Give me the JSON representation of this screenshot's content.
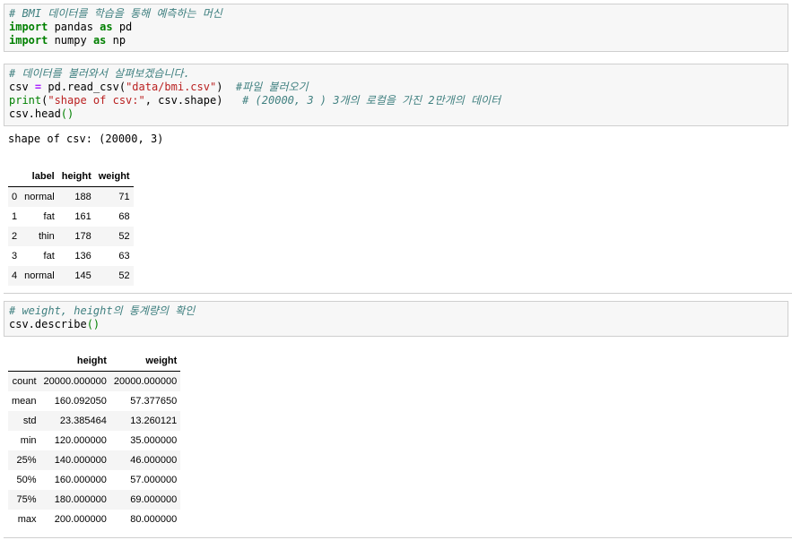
{
  "cell1": {
    "lines": [
      [
        {
          "t": "# BMI 데이터를 학습을 통해 예측하는 머신",
          "c": "cm"
        }
      ],
      [
        {
          "t": "import",
          "c": "kw"
        },
        {
          "t": " pandas ",
          "c": ""
        },
        {
          "t": "as",
          "c": "kw"
        },
        {
          "t": " pd",
          "c": ""
        }
      ],
      [
        {
          "t": "import",
          "c": "kw"
        },
        {
          "t": " numpy ",
          "c": ""
        },
        {
          "t": "as",
          "c": "kw"
        },
        {
          "t": " np",
          "c": ""
        }
      ]
    ]
  },
  "cell2": {
    "lines": [
      [
        {
          "t": "# 데이터를 불러와서 살펴보겠습니다.",
          "c": "cm"
        }
      ],
      [
        {
          "t": "csv ",
          "c": ""
        },
        {
          "t": "=",
          "c": "op"
        },
        {
          "t": " pd.read_csv(",
          "c": ""
        },
        {
          "t": "\"data/bmi.csv\"",
          "c": "st"
        },
        {
          "t": ")  ",
          "c": ""
        },
        {
          "t": "#파일 불러오기",
          "c": "cm"
        }
      ],
      [
        {
          "t": "print",
          "c": "bi"
        },
        {
          "t": "(",
          "c": ""
        },
        {
          "t": "\"shape of csv:\"",
          "c": "st"
        },
        {
          "t": ", csv.shape)   ",
          "c": ""
        },
        {
          "t": "# (20000, 3 ) 3개의 로컬을 가진 2만개의 데이터",
          "c": "cm"
        }
      ],
      [
        {
          "t": "csv.head",
          "c": ""
        },
        {
          "t": "()",
          "c": "par"
        }
      ]
    ],
    "output_text": "shape of csv: (20000, 3)",
    "table": {
      "columns": [
        "",
        "label",
        "height",
        "weight"
      ],
      "rows": [
        [
          "0",
          "normal",
          "188",
          "71"
        ],
        [
          "1",
          "fat",
          "161",
          "68"
        ],
        [
          "2",
          "thin",
          "178",
          "52"
        ],
        [
          "3",
          "fat",
          "136",
          "63"
        ],
        [
          "4",
          "normal",
          "145",
          "52"
        ]
      ]
    }
  },
  "cell3": {
    "lines": [
      [
        {
          "t": "# weight, height의 통계량의 확인",
          "c": "cm"
        }
      ],
      [
        {
          "t": "csv.describe",
          "c": ""
        },
        {
          "t": "()",
          "c": "par"
        }
      ]
    ],
    "table": {
      "columns": [
        "",
        "height",
        "weight"
      ],
      "rows": [
        [
          "count",
          "20000.000000",
          "20000.000000"
        ],
        [
          "mean",
          "160.092050",
          "57.377650"
        ],
        [
          "std",
          "23.385464",
          "13.260121"
        ],
        [
          "min",
          "120.000000",
          "35.000000"
        ],
        [
          "25%",
          "140.000000",
          "46.000000"
        ],
        [
          "50%",
          "160.000000",
          "57.000000"
        ],
        [
          "75%",
          "180.000000",
          "69.000000"
        ],
        [
          "max",
          "200.000000",
          "80.000000"
        ]
      ]
    }
  }
}
